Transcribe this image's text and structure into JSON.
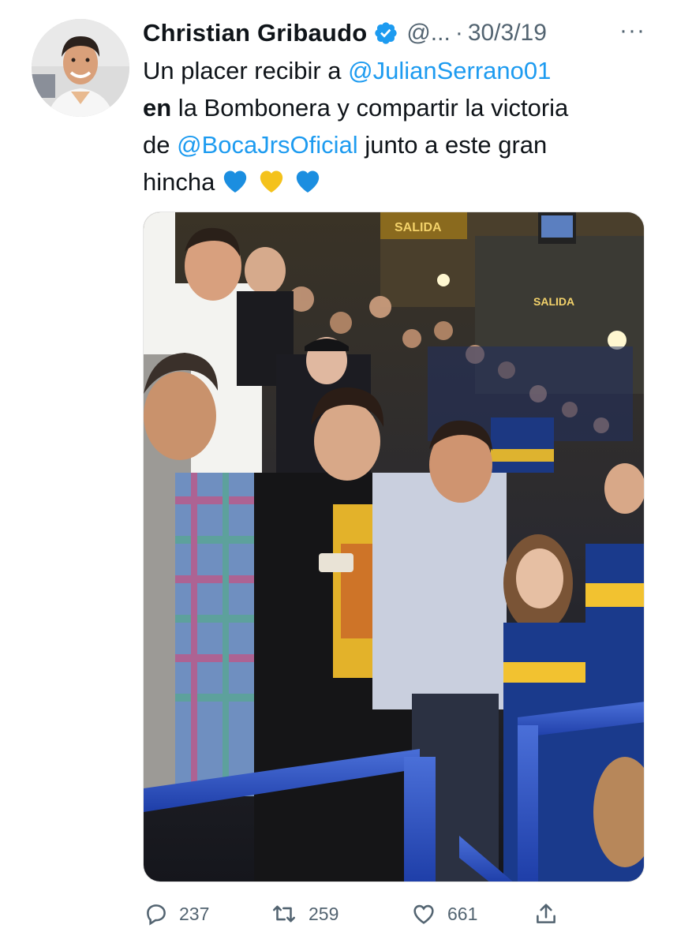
{
  "tweet": {
    "author_name": "Christian Gribaudo",
    "handle": "@...",
    "separator": "·",
    "date": "30/3/19",
    "more_label": "···",
    "verified_icon": "verified-badge-icon",
    "text": {
      "line1_prefix": "Un placer recibir a ",
      "mention1": "@JulianSerrano01",
      "bold_word": "en",
      "line2_rest": " la Bombonera y compartir la victoria",
      "line3_prefix": "de ",
      "mention2": "@BocaJrsOficial",
      "line3_rest": " junto a este gran",
      "line4": "hincha"
    },
    "emojis": [
      "blue-heart",
      "yellow-heart",
      "blue-heart"
    ],
    "photo_signs": {
      "salida1": "SALIDA",
      "salida2": "SALIDA"
    }
  },
  "actions": {
    "reply_count": "237",
    "retweet_count": "259",
    "like_count": "661"
  },
  "colors": {
    "link": "#1d9bf0",
    "muted": "#536471",
    "text": "#0f1419",
    "boca_blue": "#1a3a8c",
    "boca_yellow": "#f2c230"
  }
}
